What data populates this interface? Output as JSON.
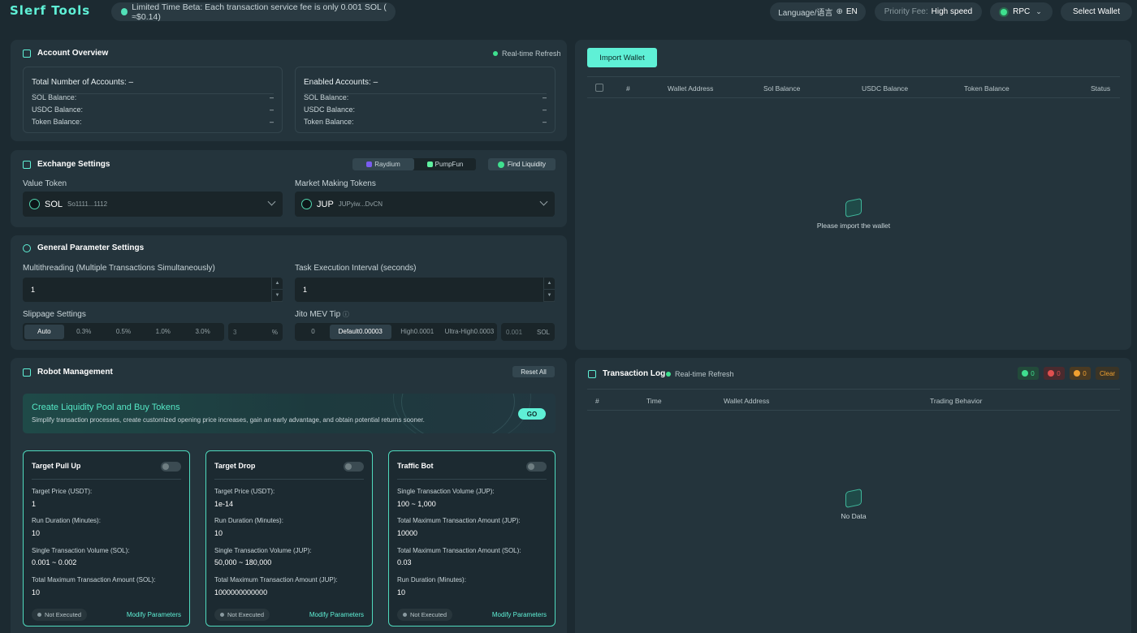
{
  "header": {
    "logo": "Slerf Tools",
    "beta_notice": "Limited Time Beta: Each transaction service fee is only 0.001 SOL ( ≈$0.14)",
    "language_label": "Language/语言",
    "language_value": "EN",
    "priority_fee_label": "Priority Fee:",
    "priority_fee_value": "High speed",
    "rpc_label": "RPC",
    "select_wallet": "Select Wallet"
  },
  "account_overview": {
    "title": "Account Overview",
    "refresh": "Real-time Refresh",
    "left": {
      "head": "Total Number of Accounts: –",
      "rows": [
        {
          "label": "SOL Balance:",
          "value": "–"
        },
        {
          "label": "USDC Balance:",
          "value": "–"
        },
        {
          "label": "Token Balance:",
          "value": "–"
        }
      ]
    },
    "right": {
      "head": "Enabled Accounts: –",
      "rows": [
        {
          "label": "SOL Balance:",
          "value": "–"
        },
        {
          "label": "USDC Balance:",
          "value": "–"
        },
        {
          "label": "Token Balance:",
          "value": "–"
        }
      ]
    }
  },
  "exchange": {
    "title": "Exchange Settings",
    "tabs": [
      "Raydium",
      "PumpFun"
    ],
    "active_tab": "Raydium",
    "find_liquidity": "Find Liquidity",
    "value_token_label": "Value Token",
    "value_token": {
      "symbol": "SOL",
      "address": "So1111...1112"
    },
    "mm_token_label": "Market Making Tokens",
    "mm_token": {
      "symbol": "JUP",
      "address": "JUPyiw...DvCN"
    }
  },
  "general": {
    "title": "General Parameter Settings",
    "multithreading_label": "Multithreading (Multiple Transactions Simultaneously)",
    "multithreading_value": "1",
    "interval_label": "Task Execution Interval (seconds)",
    "interval_value": "1",
    "slippage_label": "Slippage Settings",
    "slippage_options": [
      "Auto",
      "0.3%",
      "0.5%",
      "1.0%",
      "3.0%"
    ],
    "slippage_selected": "Auto",
    "slippage_custom_placeholder": "3",
    "slippage_unit": "%",
    "jito_label": "Jito MEV Tip",
    "jito_options": [
      "0",
      "Default0.00003",
      "High0.0001",
      "Ultra-High0.0003"
    ],
    "jito_selected": "Default0.00003",
    "jito_custom_placeholder": "0.001",
    "jito_unit": "SOL"
  },
  "robot": {
    "title": "Robot Management",
    "reset_all": "Reset All",
    "banner_title": "Create Liquidity Pool and Buy Tokens",
    "banner_desc": "Simplify transaction processes, create customized opening price increases, gain an early advantage, and obtain potential returns sooner.",
    "go": "GO",
    "cards": [
      {
        "title": "Target Pull Up",
        "fields": [
          {
            "label": "Target Price (USDT):",
            "value": "1"
          },
          {
            "label": "Run Duration (Minutes):",
            "value": "10"
          },
          {
            "label": "Single Transaction Volume (SOL):",
            "value": "0.001 ~ 0.002"
          },
          {
            "label": "Total Maximum Transaction Amount (SOL):",
            "value": "10"
          }
        ],
        "status": "Not Executed",
        "modify": "Modify Parameters"
      },
      {
        "title": "Target Drop",
        "fields": [
          {
            "label": "Target Price (USDT):",
            "value": "1e-14"
          },
          {
            "label": "Run Duration (Minutes):",
            "value": "10"
          },
          {
            "label": "Single Transaction Volume (JUP):",
            "value": "50,000 ~ 180,000"
          },
          {
            "label": "Total Maximum Transaction Amount (JUP):",
            "value": "1000000000000"
          }
        ],
        "status": "Not Executed",
        "modify": "Modify Parameters"
      },
      {
        "title": "Traffic Bot",
        "fields": [
          {
            "label": "Single Transaction Volume (JUP):",
            "value": "100 ~ 1,000"
          },
          {
            "label": "Total Maximum Transaction Amount (JUP):",
            "value": "10000"
          },
          {
            "label": "Total Maximum Transaction Amount (SOL):",
            "value": "0.03"
          },
          {
            "label": "Run Duration (Minutes):",
            "value": "10"
          }
        ],
        "status": "Not Executed",
        "modify": "Modify Parameters"
      }
    ]
  },
  "wallets": {
    "import": "Import Wallet",
    "columns": [
      "#",
      "Wallet Address",
      "Sol Balance",
      "USDC Balance",
      "Token Balance",
      "Status"
    ],
    "empty": "Please import the wallet"
  },
  "tx_log": {
    "title": "Transaction Log",
    "refresh": "Real-time Refresh",
    "success_count": "0",
    "fail_count": "0",
    "pending_count": "0",
    "clear": "Clear",
    "columns": [
      "#",
      "Time",
      "Wallet Address",
      "Trading Behavior"
    ],
    "empty": "No Data"
  },
  "colors": {
    "accent": "#5ff0d6",
    "background": "#1c2a31",
    "panel": "#24343c",
    "success": "#3fe08f",
    "error": "#e05050",
    "warning": "#f0a030"
  }
}
